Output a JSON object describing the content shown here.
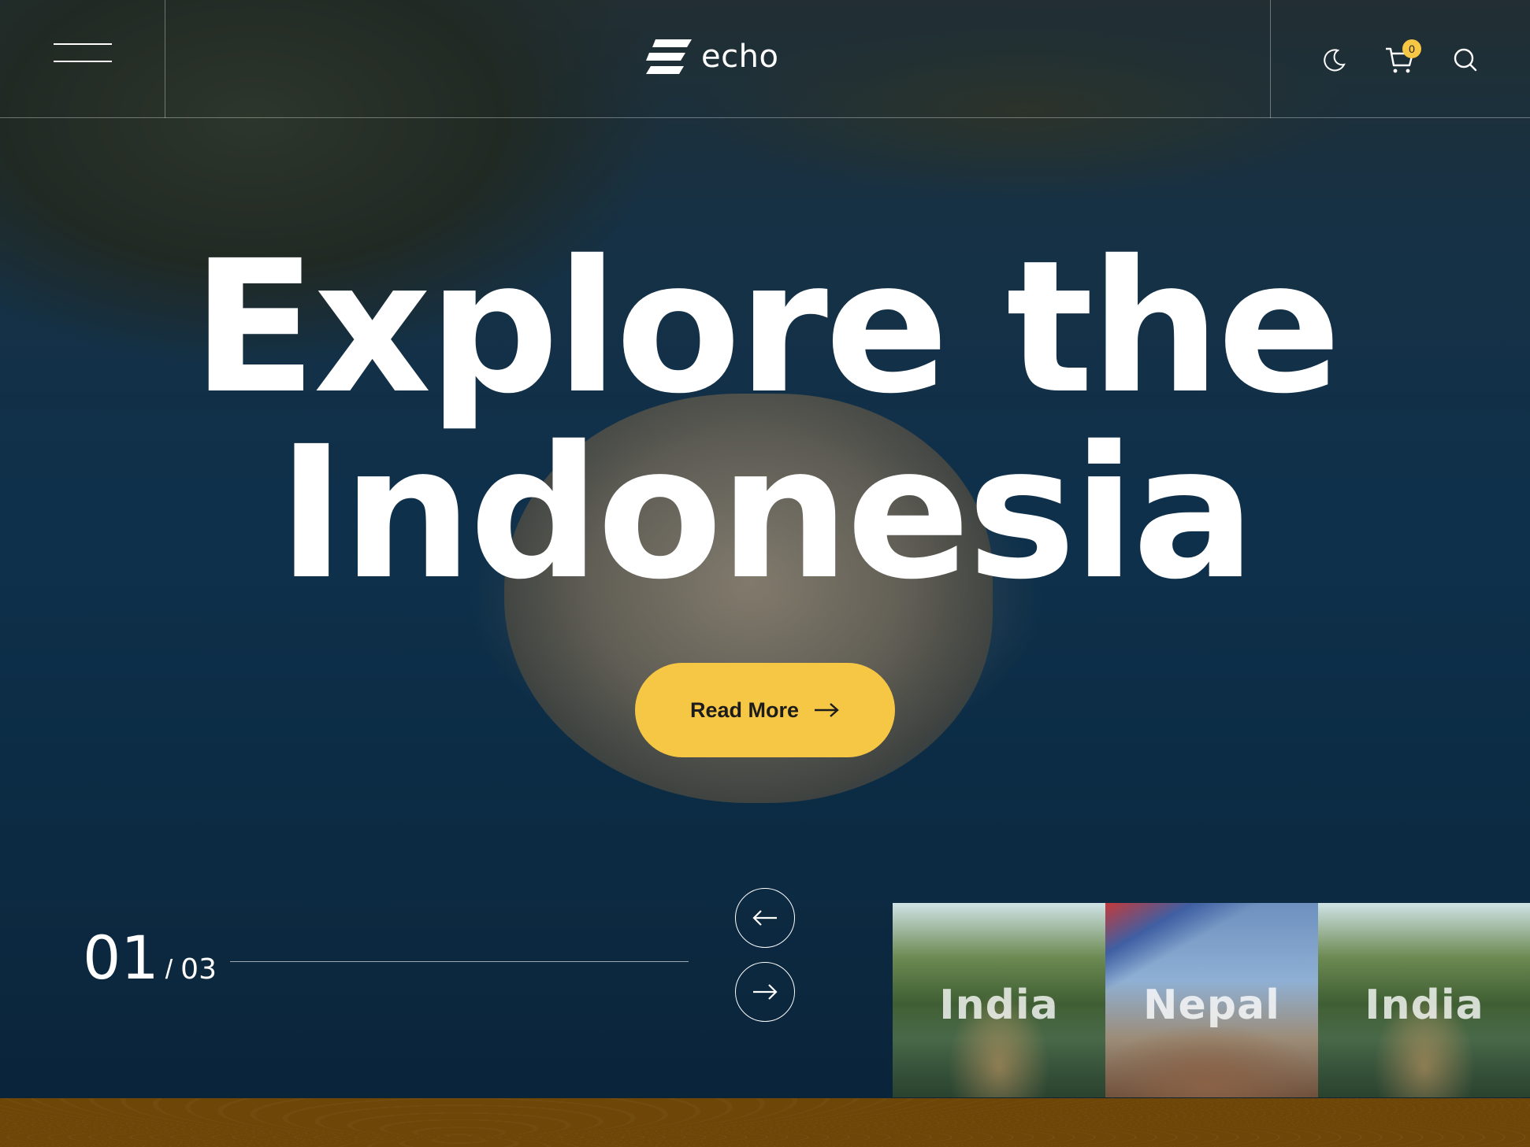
{
  "brand": {
    "name": "echo"
  },
  "header": {
    "icons": [
      "menu-icon",
      "moon-icon",
      "cart-icon",
      "search-icon"
    ],
    "cart_count": "0"
  },
  "hero": {
    "title_line1": "Explore the",
    "title_line2": "Indonesia",
    "cta_label": "Read More"
  },
  "slider": {
    "current": "01",
    "separator": "/",
    "total": "03",
    "progress": 0.33
  },
  "thumbnails": [
    {
      "label": "India"
    },
    {
      "label": "Nepal"
    },
    {
      "label": "India"
    }
  ],
  "colors": {
    "accent": "#f6c744",
    "footer_band": "#6e4708",
    "text": "#ffffff"
  }
}
